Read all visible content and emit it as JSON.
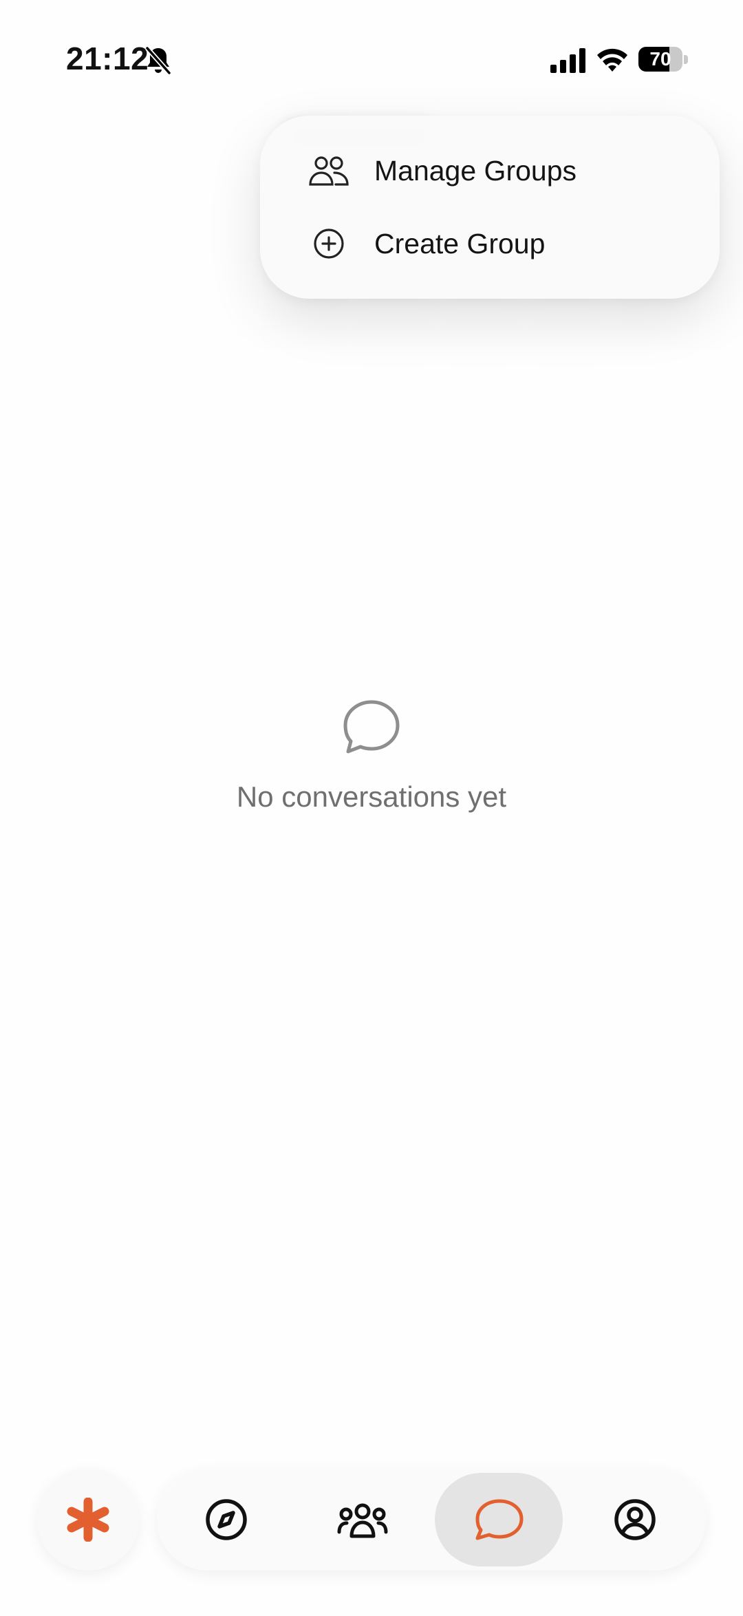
{
  "status_bar": {
    "time": "21:12",
    "battery_level": "70",
    "battery_percent": 70,
    "icons": [
      "bell-slash-icon",
      "cellular-signal-icon",
      "wifi-icon",
      "battery-icon"
    ]
  },
  "menu": {
    "items": [
      {
        "label": "Manage Groups",
        "icon": "people-icon"
      },
      {
        "label": "Create Group",
        "icon": "plus-circle-icon"
      }
    ]
  },
  "empty_state": {
    "icon": "chat-bubble-icon",
    "message": "No conversations yet"
  },
  "bottom_nav": {
    "fab_icon": "asterisk-icon",
    "tabs": [
      {
        "icon": "compass-icon",
        "active": false
      },
      {
        "icon": "community-icon",
        "active": false
      },
      {
        "icon": "chat-bubble-icon",
        "active": true
      },
      {
        "icon": "profile-icon",
        "active": false
      }
    ]
  },
  "colors": {
    "accent": "#E2602F",
    "active_tab_bg": "#E4E4E4",
    "muted_text": "#6F6F6F"
  }
}
